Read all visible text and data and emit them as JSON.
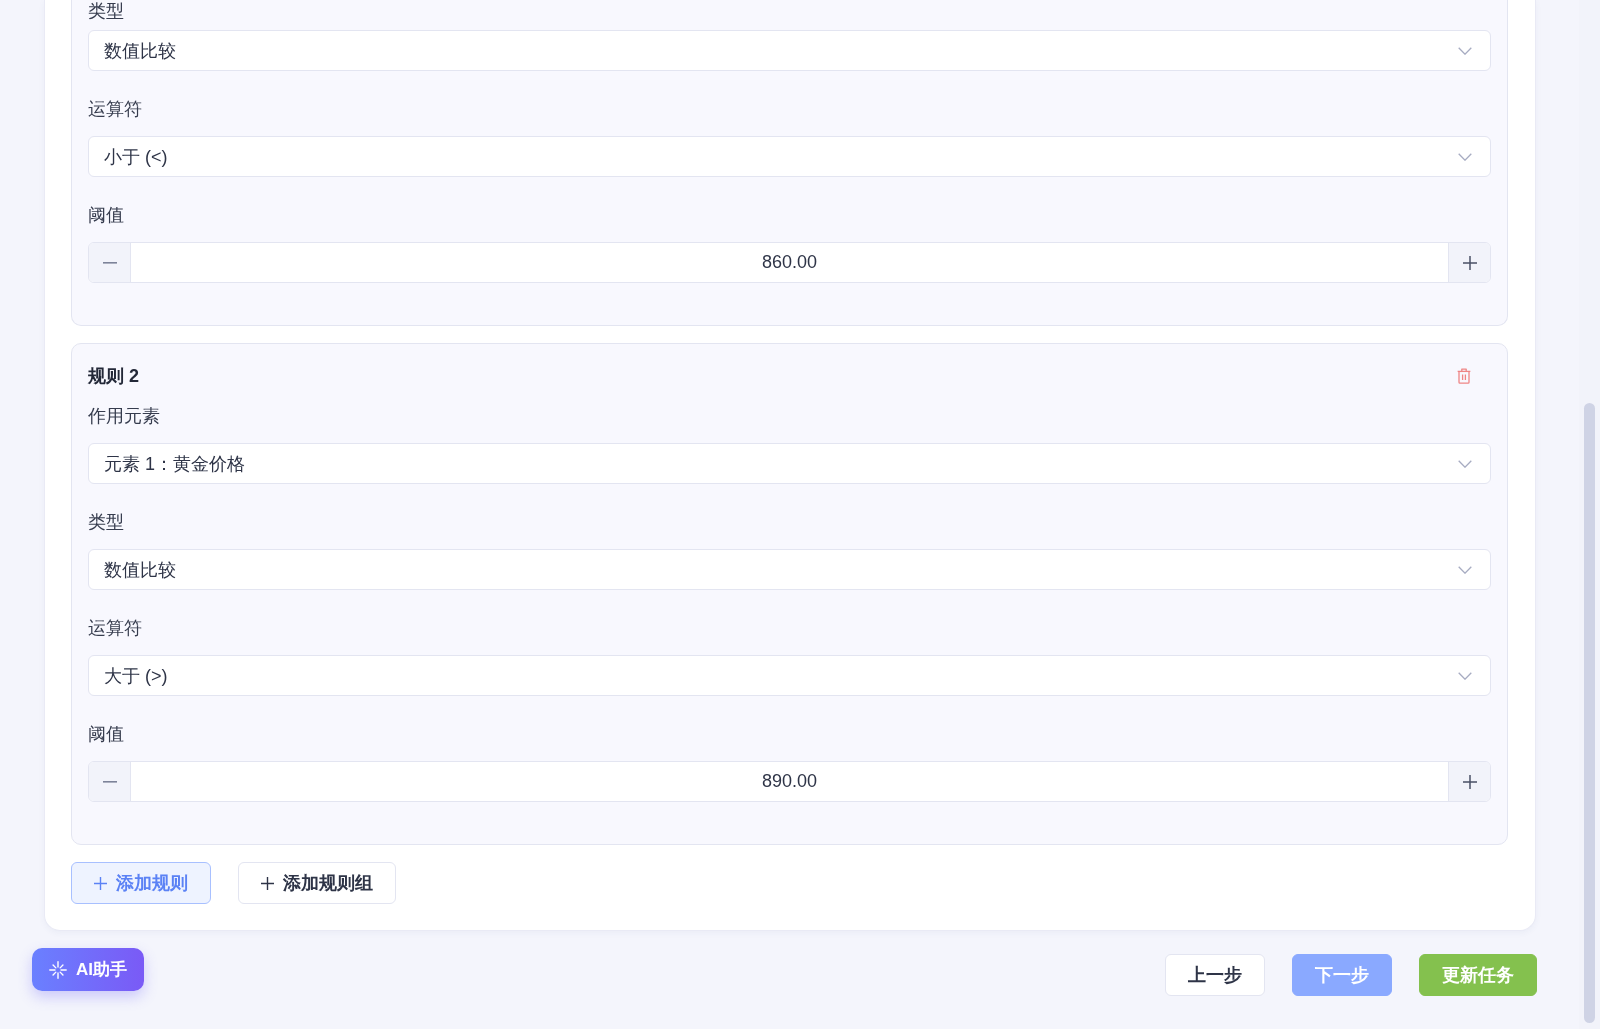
{
  "rules": [
    {
      "fields": [
        {
          "kind": "select",
          "label": "类型",
          "value": "数值比较"
        },
        {
          "kind": "select",
          "label": "运算符",
          "value": "小于 (<)"
        },
        {
          "kind": "number",
          "label": "阈值",
          "value": "860.00"
        }
      ]
    },
    {
      "title": "规则 2",
      "fields": [
        {
          "kind": "select",
          "label": "作用元素",
          "value": "元素 1：黄金价格"
        },
        {
          "kind": "select",
          "label": "类型",
          "value": "数值比较"
        },
        {
          "kind": "select",
          "label": "运算符",
          "value": "大于 (>)"
        },
        {
          "kind": "number",
          "label": "阈值",
          "value": "890.00"
        }
      ]
    }
  ],
  "add_buttons": [
    {
      "kind": "primary",
      "label": "添加规则"
    },
    {
      "kind": "default",
      "label": "添加规则组"
    }
  ],
  "ai_assistant": {
    "label": "AI助手"
  },
  "nav_buttons": [
    {
      "kind": "default",
      "label": "上一步",
      "disabled": false
    },
    {
      "kind": "primary",
      "label": "下一步",
      "disabled": true
    },
    {
      "kind": "success",
      "label": "更新任务",
      "disabled": false
    }
  ]
}
